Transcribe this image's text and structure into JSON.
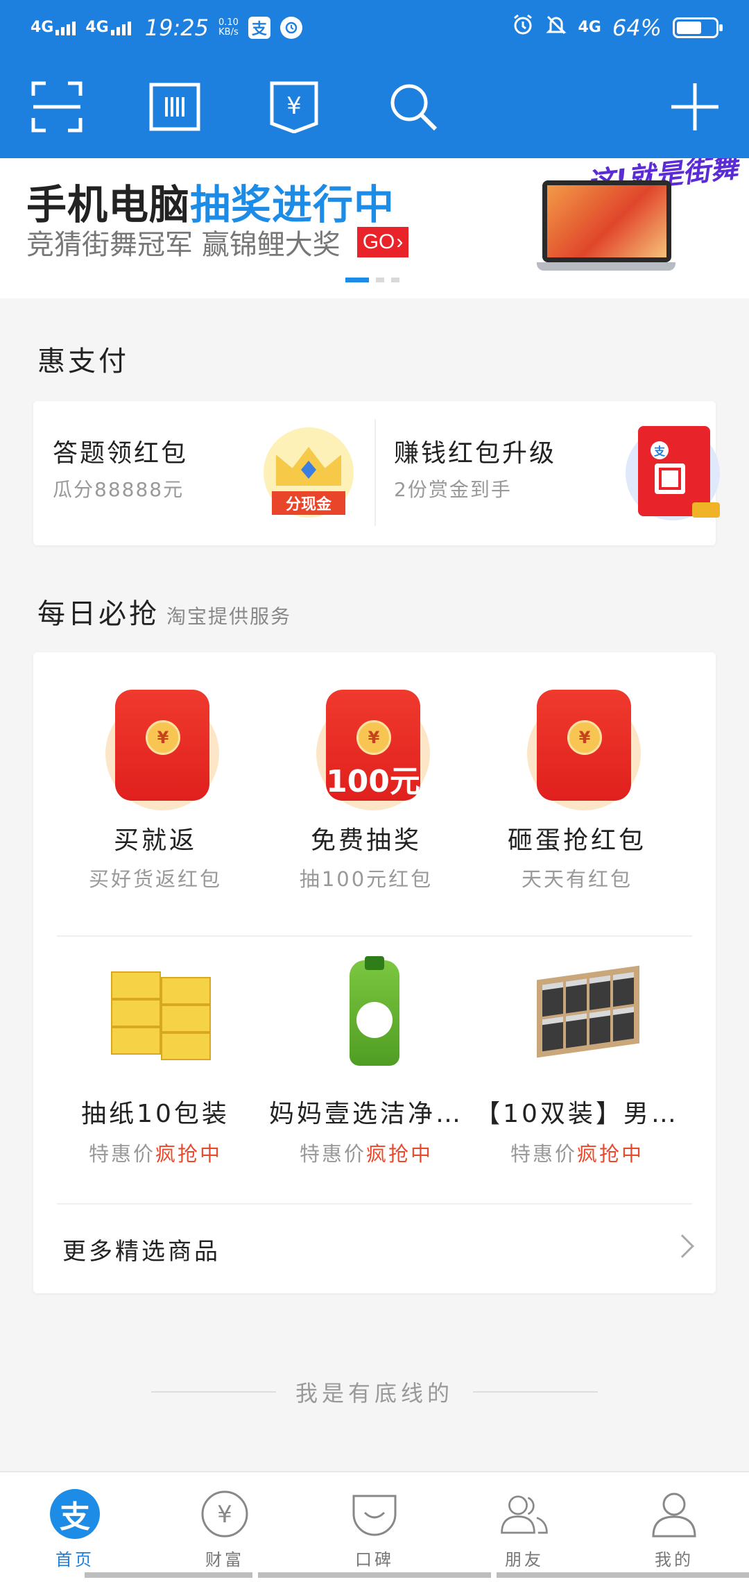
{
  "status_bar": {
    "network1": "4G",
    "network2": "4G",
    "time": "19:25",
    "speed_value": "0.10",
    "speed_unit": "KB/s",
    "alipay_glyph": "支",
    "right_network": "4G",
    "battery_text": "64%",
    "battery_level": 0.64
  },
  "toolbar": {
    "icons": [
      "scan-icon",
      "barcode-icon",
      "pay-code-icon",
      "search-icon",
      "add-icon"
    ],
    "bill_glyph": "¥"
  },
  "banner": {
    "title_plain": "手机电脑",
    "title_highlight": "抽奖进行中",
    "subtitle": "竞猜街舞冠军 赢锦鲤大奖",
    "go_label": "GO",
    "go_arrow": "›",
    "deco_text": "这!就是街舞",
    "active_dot": 0,
    "dot_count": 3
  },
  "hui_zhifu": {
    "title": "惠支付",
    "items": [
      {
        "title": "答题领红包",
        "subtitle": "瓜分88888元",
        "image_tag": "分现金"
      },
      {
        "title": "赚钱红包升级",
        "subtitle": "2份赏金到手",
        "logo": "支"
      }
    ]
  },
  "daily": {
    "title": "每日必抢",
    "provider": "淘宝提供服务",
    "coin_glyph": "¥",
    "row1": [
      {
        "title": "买就返",
        "subtitle": "买好货返红包"
      },
      {
        "title": "免费抽奖",
        "subtitle": "抽100元红包",
        "badge": "100元"
      },
      {
        "title": "砸蛋抢红包",
        "subtitle": "天天有红包"
      }
    ],
    "row2": [
      {
        "title": "抽纸10包装",
        "price_label": "特惠价",
        "status": "疯抢中"
      },
      {
        "title": "妈妈壹选洁净…",
        "price_label": "特惠价",
        "status": "疯抢中"
      },
      {
        "title": "【10双装】男…",
        "price_label": "特惠价",
        "status": "疯抢中"
      }
    ],
    "more_label": "更多精选商品"
  },
  "footer_text": "我是有底线的",
  "tabbar": {
    "active": 0,
    "tabs": [
      {
        "label": "首页",
        "glyph": "支"
      },
      {
        "label": "财富",
        "glyph": "¥"
      },
      {
        "label": "口碑"
      },
      {
        "label": "朋友"
      },
      {
        "label": "我的"
      }
    ]
  },
  "colors": {
    "brand_blue": "#1d7fde",
    "highlight_blue": "#1d8ce6",
    "hot_red": "#e84a2c"
  }
}
